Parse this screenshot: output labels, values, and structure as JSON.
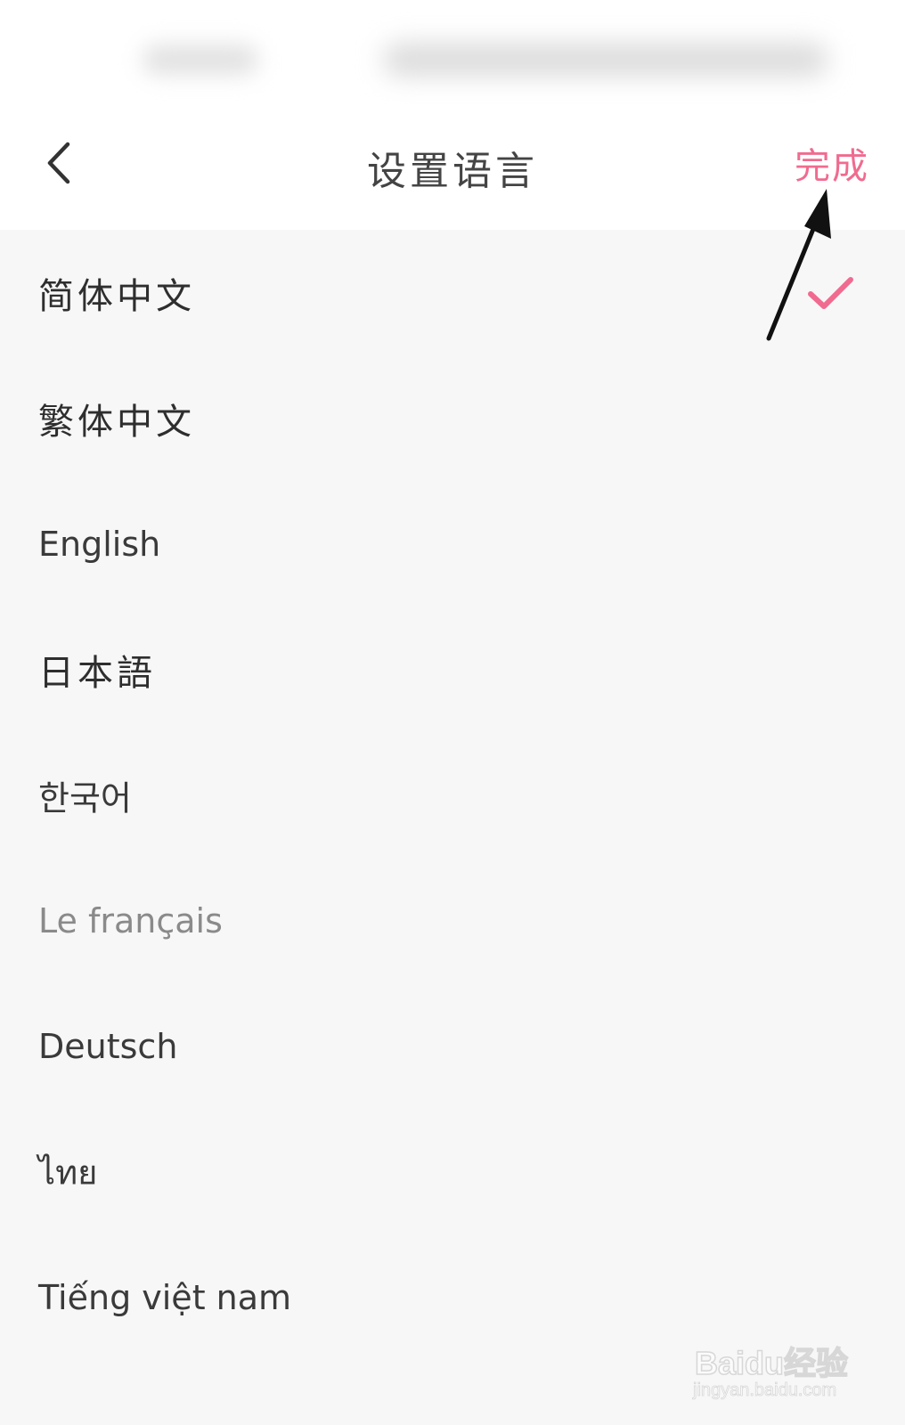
{
  "header": {
    "title": "设置语言",
    "done_label": "完成",
    "accent_color": "#f06b8f"
  },
  "languages": [
    {
      "label": "简体中文",
      "selected": true
    },
    {
      "label": "繁体中文",
      "selected": false
    },
    {
      "label": "English",
      "selected": false
    },
    {
      "label": "日本語",
      "selected": false
    },
    {
      "label": "한국어",
      "selected": false
    },
    {
      "label": "Le français",
      "selected": false
    },
    {
      "label": "Deutsch",
      "selected": false
    },
    {
      "label": "ไทย",
      "selected": false
    },
    {
      "label": "Tiếng việt nam",
      "selected": false
    }
  ],
  "icons": {
    "back": "chevron-left-icon",
    "selected": "checkmark-icon"
  },
  "watermark": {
    "brand": "Baidu经验",
    "url": "jingyan.baidu.com"
  }
}
